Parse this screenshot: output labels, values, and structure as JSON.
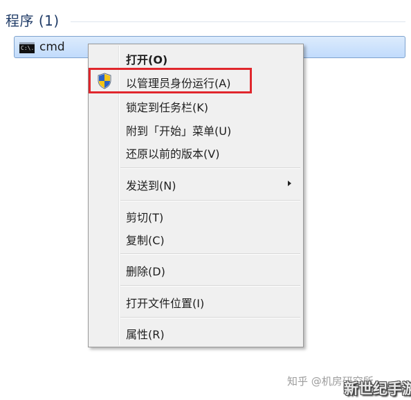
{
  "section": {
    "title": "程序 (1)"
  },
  "result": {
    "label": "cmd",
    "icon": "console-icon",
    "icon_text": "C:\\."
  },
  "context_menu": {
    "items": [
      {
        "label": "打开(O)",
        "default": true
      },
      {
        "label": "以管理员身份运行(A)",
        "icon": "uac-shield-icon",
        "highlighted": true
      },
      {
        "label": "锁定到任务栏(K)"
      },
      {
        "label": "附到「开始」菜单(U)"
      },
      {
        "label": "还原以前的版本(V)"
      },
      {
        "label": "发送到(N)",
        "submenu": true
      },
      {
        "label": "剪切(T)"
      },
      {
        "label": "复制(C)"
      },
      {
        "label": "删除(D)"
      },
      {
        "label": "打开文件位置(I)"
      },
      {
        "label": "属性(R)"
      }
    ]
  },
  "annotation": {
    "color": "#e0262c"
  },
  "watermark": {
    "text": "知乎 @机房研究所"
  },
  "brand": {
    "text": "新世纪手游"
  },
  "colors": {
    "selection_bg": "#c1dbfc",
    "selection_border": "#7da2ce",
    "menu_bg": "#f0f0f0"
  }
}
